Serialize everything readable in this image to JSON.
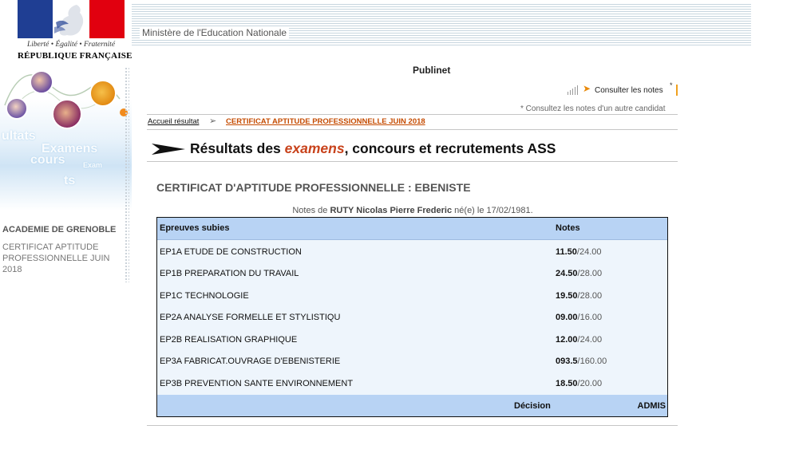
{
  "brand": {
    "devise": "Liberté • Égalité • Fraternité",
    "republique": "RÉPUBLIQUE FRANÇAISE",
    "flag_colors": [
      "#1f3e93",
      "#ffffff",
      "#e1000f"
    ]
  },
  "header": {
    "ministry": "Ministère de l'Education Nationale",
    "app_name": "Publinet"
  },
  "decoration": {
    "words": [
      "ultats",
      "Examens",
      "cours",
      "Exam",
      "ts"
    ]
  },
  "sidebar": {
    "academie": "ACADEMIE DE GRENOBLE",
    "exam": "CERTIFICAT APTITUDE PROFESSIONNELLE JUIN 2018"
  },
  "toolbar": {
    "consult_label": "Consulter les notes",
    "consult_star": "*",
    "other_note": "* Consultez les notes d'un autre candidat"
  },
  "breadcrumb": {
    "home": "Accueil résultat",
    "separator": "➢",
    "current": "CERTIFICAT APTITUDE PROFESSIONNELLE JUIN 2018"
  },
  "page": {
    "title_before": "Résultats des ",
    "title_em": "examens",
    "title_after": ", concours et recrutements ASS",
    "exam_title": "CERTIFICAT D'APTITUDE PROFESSIONNELLE : EBENISTE"
  },
  "candidate": {
    "prefix": "Notes de ",
    "name": "RUTY Nicolas Pierre Frederic",
    "suffix": " né(e) le 17/02/1981."
  },
  "results": {
    "col_epreuves": "Epreuves subies",
    "col_notes": "Notes",
    "rows": [
      {
        "epreuve": "EP1A ETUDE DE CONSTRUCTION",
        "note": "11.50",
        "max": "/24.00"
      },
      {
        "epreuve": "EP1B PREPARATION DU TRAVAIL",
        "note": "24.50",
        "max": "/28.00"
      },
      {
        "epreuve": "EP1C TECHNOLOGIE",
        "note": "19.50",
        "max": "/28.00"
      },
      {
        "epreuve": "EP2A ANALYSE FORMELLE ET STYLISTIQU",
        "note": "09.00",
        "max": "/16.00"
      },
      {
        "epreuve": "EP2B REALISATION GRAPHIQUE",
        "note": "12.00",
        "max": "/24.00"
      },
      {
        "epreuve": "EP3A FABRICAT.OUVRAGE D'EBENISTERIE",
        "note": "093.5",
        "max": "/160.00"
      },
      {
        "epreuve": "EP3B PREVENTION SANTE ENVIRONNEMENT",
        "note": "18.50",
        "max": "/20.00"
      }
    ],
    "decision_label": "Décision",
    "decision_value": "ADMIS"
  },
  "colors": {
    "accent_orange": "#c8421b",
    "table_header_blue": "#b8d3f4",
    "table_body": "#eef5fc"
  }
}
